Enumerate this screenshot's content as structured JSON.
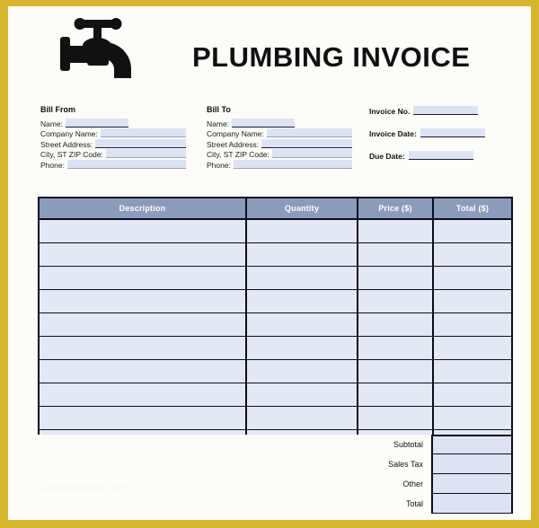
{
  "document": {
    "title": "PLUMBING INVOICE",
    "logo_icon": "faucet-icon",
    "border_color": "#d6b62e",
    "page_background": "#fdfcf9",
    "watermark_text": "www.template.net"
  },
  "bill_from": {
    "heading": "Bill From",
    "fields": [
      {
        "label": "Name:",
        "value": ""
      },
      {
        "label": "Company  Name:",
        "value": ""
      },
      {
        "label": "Street Address:",
        "value": ""
      },
      {
        "label": "City, ST ZIP  Code:",
        "value": ""
      },
      {
        "label": "Phone:",
        "value": ""
      }
    ]
  },
  "bill_to": {
    "heading": "Bill To",
    "fields": [
      {
        "label": "Name:",
        "value": ""
      },
      {
        "label": "Company  Name:",
        "value": ""
      },
      {
        "label": "Street Address:",
        "value": ""
      },
      {
        "label": "City, ST ZIP  Code:",
        "value": ""
      },
      {
        "label": "Phone:",
        "value": ""
      }
    ]
  },
  "invoice_meta": {
    "fields": [
      {
        "label": "Invoice No.",
        "value": ""
      },
      {
        "label": "Invoice  Date:",
        "value": ""
      },
      {
        "label": "Due Date:",
        "value": ""
      }
    ]
  },
  "items_table": {
    "header_background": "#8b9bba",
    "row_background": "#e3e8f5",
    "columns": [
      {
        "label": "Description",
        "key": "description"
      },
      {
        "label": "Quantity",
        "key": "quantity"
      },
      {
        "label": "Price ($)",
        "key": "price"
      },
      {
        "label": "Total ($)",
        "key": "total"
      }
    ],
    "rows": [
      {
        "description": "",
        "quantity": "",
        "price": "",
        "total": ""
      },
      {
        "description": "",
        "quantity": "",
        "price": "",
        "total": ""
      },
      {
        "description": "",
        "quantity": "",
        "price": "",
        "total": ""
      },
      {
        "description": "",
        "quantity": "",
        "price": "",
        "total": ""
      },
      {
        "description": "",
        "quantity": "",
        "price": "",
        "total": ""
      },
      {
        "description": "",
        "quantity": "",
        "price": "",
        "total": ""
      },
      {
        "description": "",
        "quantity": "",
        "price": "",
        "total": ""
      },
      {
        "description": "",
        "quantity": "",
        "price": "",
        "total": ""
      },
      {
        "description": "",
        "quantity": "",
        "price": "",
        "total": ""
      },
      {
        "description": "",
        "quantity": "",
        "price": "",
        "total": ""
      }
    ]
  },
  "totals": {
    "rows": [
      {
        "label": "Subtotal",
        "value": ""
      },
      {
        "label": "Sales Tax",
        "value": ""
      },
      {
        "label": "Other",
        "value": ""
      },
      {
        "label": "Total",
        "value": ""
      }
    ]
  }
}
